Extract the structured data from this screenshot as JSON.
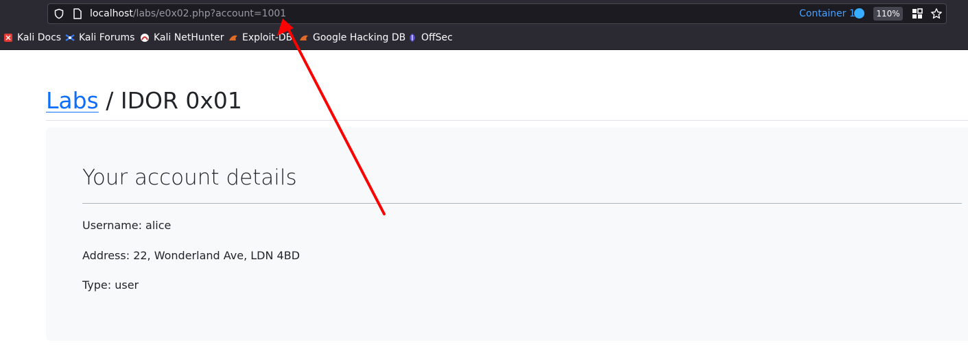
{
  "browser": {
    "url": {
      "host": "localhost",
      "path": "/labs/e0x02.php?account=1001"
    },
    "container_label": "Container 1",
    "zoom": "110%",
    "icons": [
      "shield-icon",
      "page-icon",
      "qr-icon",
      "star-icon"
    ],
    "bookmarks": [
      {
        "label": "Kali Docs",
        "icon": "kali-docs-icon"
      },
      {
        "label": "Kali Forums",
        "icon": "kali-forums-icon"
      },
      {
        "label": "Kali NetHunter",
        "icon": "kali-nethunter-icon"
      },
      {
        "label": "Exploit-DB",
        "icon": "exploit-db-icon"
      },
      {
        "label": "Google Hacking DB",
        "icon": "google-hacking-db-icon"
      },
      {
        "label": "OffSec",
        "icon": "offsec-icon"
      }
    ]
  },
  "page": {
    "breadcrumb": {
      "link": "Labs",
      "separator": " / ",
      "current": "IDOR 0x01"
    },
    "card": {
      "title": "Your account details",
      "username": "Username: alice",
      "address": "Address: 22, Wonderland Ave, LDN 4BD",
      "type": "Type: user"
    }
  },
  "annotation": {
    "type": "arrow",
    "color": "#ff0000"
  },
  "colors": {
    "chrome": "#2b2a33",
    "link": "#0d6efd",
    "container": "#45a1ff",
    "card": "#f8f9fa"
  }
}
